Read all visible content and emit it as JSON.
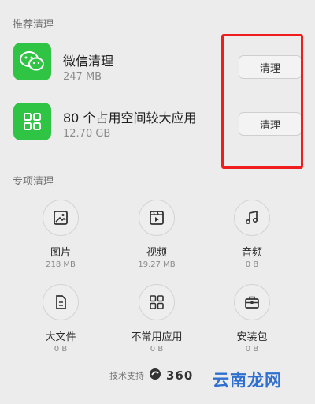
{
  "recommended": {
    "title": "推荐清理",
    "items": [
      {
        "title": "微信清理",
        "size": "247 MB",
        "button": "清理"
      },
      {
        "title": "80 个占用空间较大应用",
        "size": "12.70 GB",
        "button": "清理"
      }
    ]
  },
  "special": {
    "title": "专项清理",
    "tools": [
      {
        "label": "图片",
        "size": "218 MB",
        "icon": "image-icon"
      },
      {
        "label": "视频",
        "size": "19.27 MB",
        "icon": "video-icon"
      },
      {
        "label": "音频",
        "size": "0 B",
        "icon": "music-icon"
      },
      {
        "label": "大文件",
        "size": "0 B",
        "icon": "file-icon"
      },
      {
        "label": "不常用应用",
        "size": "0 B",
        "icon": "apps-icon"
      },
      {
        "label": "安装包",
        "size": "0 B",
        "icon": "briefcase-icon"
      }
    ]
  },
  "footer": {
    "support_text": "技术支持",
    "brand": "360"
  },
  "watermark": "云南龙网",
  "colors": {
    "accent_green": "#2fc444",
    "highlight_red": "#ef1d1d",
    "watermark_blue": "#2e6fcf"
  }
}
